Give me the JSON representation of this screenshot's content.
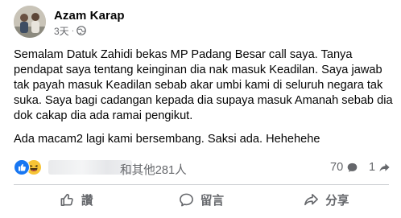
{
  "post": {
    "author": "Azam Karap",
    "time": "3天",
    "separator": "·",
    "paragraphs": [
      "Semalam Datuk Zahidi bekas MP Padang Besar call saya. Tanya pendapat saya tentang keinginan dia nak masuk Keadilan. Saya jawab tak payah masuk Keadilan sebab akar umbi kami di seluruh negara tak suka. Saya bagi cadangan kepada dia supaya masuk Amanah sebab dia dok cakap dia ada ramai pengikut.",
      "Ada macam2 lagi kami bersembang. Saksi ada. Hehehehe"
    ]
  },
  "reactions": {
    "icons": [
      "like-icon",
      "haha-icon"
    ],
    "summary": "和其他281人",
    "comments": "70",
    "shares": "1"
  },
  "actions": {
    "like": "讚",
    "comment": "留言",
    "share": "分享"
  },
  "colors": {
    "primary_text": "#050505",
    "secondary_text": "#65676b",
    "like_blue": "#1877f2",
    "haha_yellow": "#f7c436",
    "divider": "#ced0d4"
  }
}
